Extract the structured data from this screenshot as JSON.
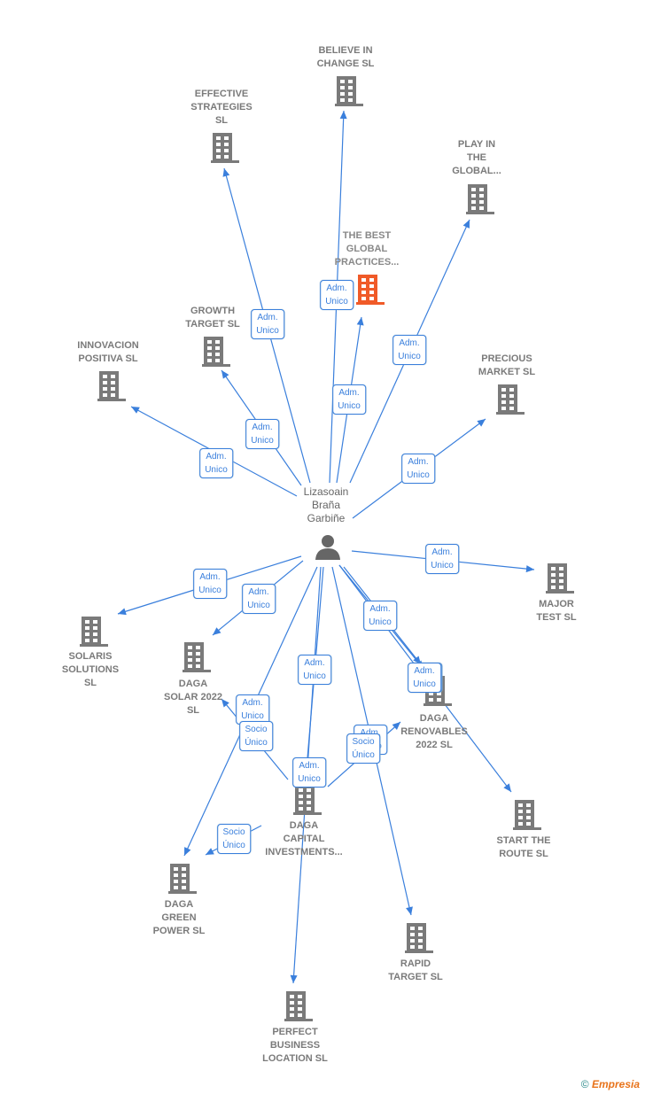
{
  "center": {
    "name": "Lizasoain Braña Garbiñe",
    "icon": "person-icon"
  },
  "nodes": [
    {
      "id": "believe",
      "name": "BELIEVE IN CHANGE  SL",
      "lines": [
        "BELIEVE IN",
        "CHANGE  SL"
      ]
    },
    {
      "id": "effective",
      "name": "EFFECTIVE STRATEGIES SL",
      "lines": [
        "EFFECTIVE",
        "STRATEGIES",
        "SL"
      ]
    },
    {
      "id": "play",
      "name": "PLAY IN THE GLOBAL...",
      "lines": [
        "PLAY IN",
        "THE",
        "GLOBAL..."
      ]
    },
    {
      "id": "best",
      "name": "THE BEST GLOBAL PRACTICES...",
      "lines": [
        "THE BEST",
        "GLOBAL",
        "PRACTICES..."
      ],
      "highlight": true
    },
    {
      "id": "growth",
      "name": "GROWTH TARGET SL",
      "lines": [
        "GROWTH",
        "TARGET SL"
      ]
    },
    {
      "id": "innovacion",
      "name": "INNOVACION POSITIVA  SL",
      "lines": [
        "INNOVACION",
        "POSITIVA  SL"
      ]
    },
    {
      "id": "precious",
      "name": "PRECIOUS MARKET  SL",
      "lines": [
        "PRECIOUS",
        "MARKET  SL"
      ]
    },
    {
      "id": "major",
      "name": "MAJOR TEST  SL",
      "lines": [
        "MAJOR",
        "TEST  SL"
      ]
    },
    {
      "id": "solaris",
      "name": "SOLARIS SOLUTIONS SL",
      "lines": [
        "SOLARIS",
        "SOLUTIONS",
        "SL"
      ]
    },
    {
      "id": "dagasolar",
      "name": "DAGA SOLAR 2022 SL",
      "lines": [
        "DAGA",
        "SOLAR 2022",
        "SL"
      ]
    },
    {
      "id": "dagarenov",
      "name": "DAGA RENOVABLES 2022  SL",
      "lines": [
        "DAGA",
        "RENOVABLES",
        "2022  SL"
      ]
    },
    {
      "id": "start",
      "name": "START THE ROUTE  SL",
      "lines": [
        "START THE",
        "ROUTE  SL"
      ]
    },
    {
      "id": "dagacapital",
      "name": "DAGA CAPITAL INVESTMENTS...",
      "lines": [
        "DAGA",
        "CAPITAL",
        "INVESTMENTS..."
      ]
    },
    {
      "id": "dagagreen",
      "name": "DAGA GREEN POWER  SL",
      "lines": [
        "DAGA",
        "GREEN",
        "POWER  SL"
      ]
    },
    {
      "id": "rapid",
      "name": "RAPID TARGET  SL",
      "lines": [
        "RAPID",
        "TARGET  SL"
      ]
    },
    {
      "id": "perfect",
      "name": "PERFECT BUSINESS LOCATION  SL",
      "lines": [
        "PERFECT",
        "BUSINESS",
        "LOCATION  SL"
      ]
    }
  ],
  "edges": [
    {
      "from": "center",
      "to": "believe",
      "label": "Adm.\nUnico"
    },
    {
      "from": "center",
      "to": "effective",
      "label": "Adm.\nUnico"
    },
    {
      "from": "center",
      "to": "play",
      "label": "Adm.\nUnico"
    },
    {
      "from": "center",
      "to": "best",
      "label": "Adm.\nUnico"
    },
    {
      "from": "center",
      "to": "growth",
      "label": "Adm.\nUnico"
    },
    {
      "from": "center",
      "to": "innovacion",
      "label": "Adm.\nUnico"
    },
    {
      "from": "center",
      "to": "precious",
      "label": "Adm.\nUnico"
    },
    {
      "from": "center",
      "to": "major",
      "label": "Adm.\nUnico"
    },
    {
      "from": "center",
      "to": "solaris",
      "label": "Adm.\nUnico"
    },
    {
      "from": "center",
      "to": "dagasolar",
      "label": "Adm.\nUnico"
    },
    {
      "from": "center",
      "to": "dagarenov",
      "label": "Adm.\nUnico"
    },
    {
      "from": "center",
      "to": "start",
      "label": "Adm.\nUnico"
    },
    {
      "from": "center",
      "to": "dagacapital",
      "label": "Adm.\nUnico"
    },
    {
      "from": "center",
      "to": "dagagreen",
      "label": "Adm.\nUnico"
    },
    {
      "from": "center",
      "to": "rapid",
      "label": "Adm.\nUnico"
    },
    {
      "from": "center",
      "to": "perfect",
      "label": "Adm.\nUnico"
    },
    {
      "from": "dagacapital",
      "to": "dagasolar",
      "label": "Socio\nÚnico"
    },
    {
      "from": "dagacapital",
      "to": "dagarenov",
      "label": "Socio\nÚnico"
    },
    {
      "from": "dagacapital",
      "to": "dagagreen",
      "label": "Socio\nÚnico"
    },
    {
      "from": "center",
      "to": "dagarenov",
      "label": "Adm.\nUnico"
    }
  ],
  "colors": {
    "edge": "#3a7fdc",
    "node": "#7a7a7a",
    "highlight": "#f05a28"
  },
  "footer": {
    "copyright": "©",
    "brand": "Empresia"
  }
}
